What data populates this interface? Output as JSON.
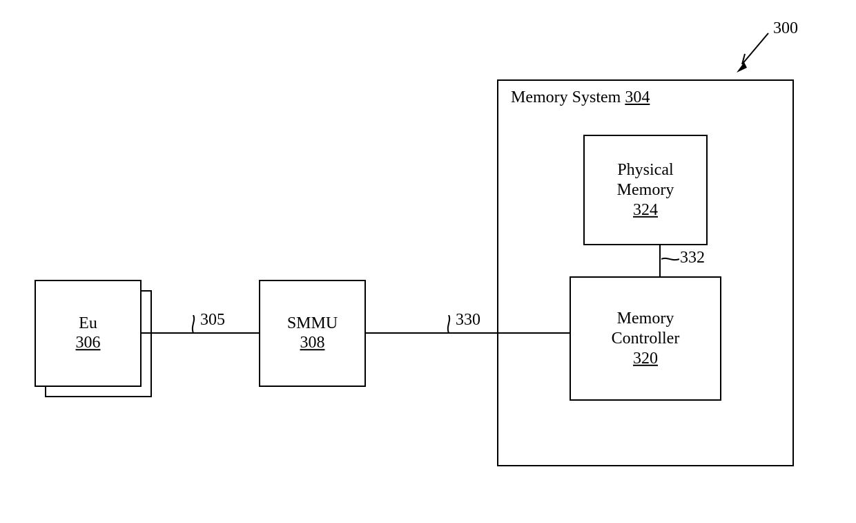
{
  "figure_ref": "300",
  "eu": {
    "label": "Eu",
    "ref": "306"
  },
  "smmu": {
    "label": "SMMU",
    "ref": "308"
  },
  "memory_system": {
    "label": "Memory System",
    "ref": "304"
  },
  "physical_memory": {
    "label1": "Physical",
    "label2": "Memory",
    "ref": "324"
  },
  "memory_controller": {
    "label1": "Memory",
    "label2": "Controller",
    "ref": "320"
  },
  "conn_eu_smmu": "305",
  "conn_smmu_memctrl": "330",
  "conn_memctrl_phys": "332"
}
